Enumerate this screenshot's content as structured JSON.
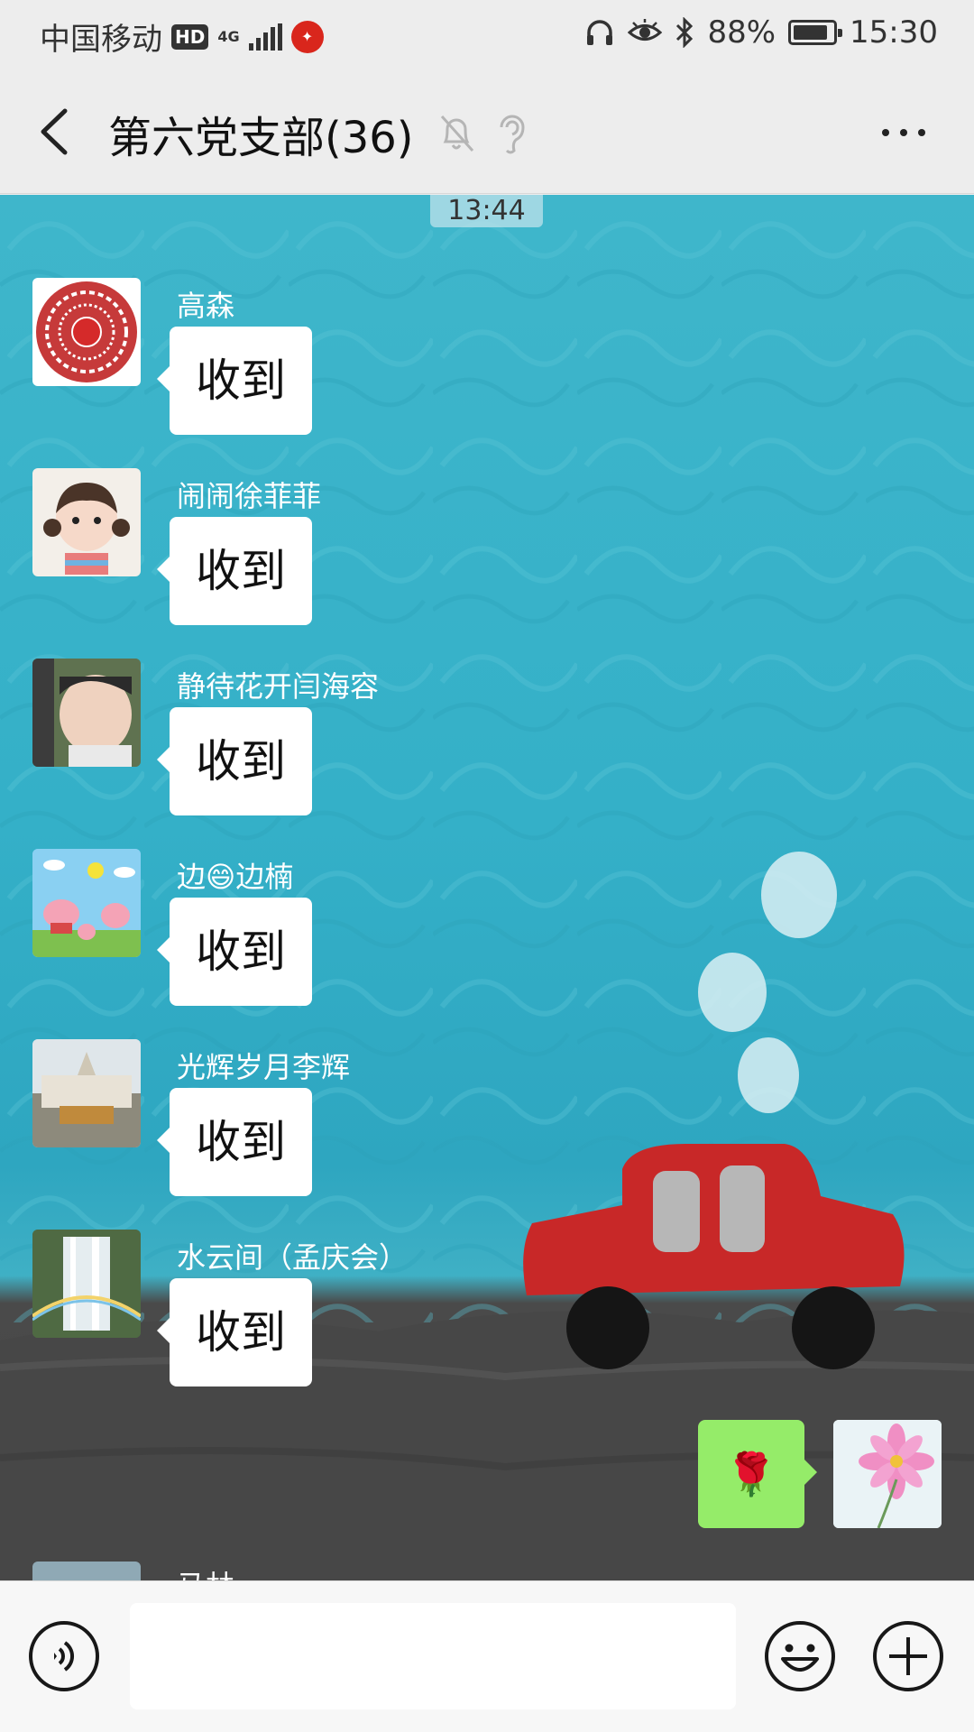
{
  "status_bar": {
    "carrier": "中国移动",
    "hd": "HD",
    "network": "4G",
    "battery_percent": "88%",
    "battery_level": 0.88,
    "time": "15:30"
  },
  "header": {
    "title": "第六党支部(36)"
  },
  "chat": {
    "timestamp": "13:44",
    "messages": [
      {
        "sender": "高森",
        "text": "收到"
      },
      {
        "sender": "闹闹徐菲菲",
        "text": "收到"
      },
      {
        "sender": "静待花开闫海容",
        "text": "收到"
      },
      {
        "sender": "边😄边楠",
        "text": "收到"
      },
      {
        "sender": "光辉岁月李辉",
        "text": "收到"
      },
      {
        "sender": "水云间（孟庆会）",
        "text": "收到"
      }
    ],
    "my_message": {
      "content": "🌹"
    },
    "partial_sender": "马林"
  },
  "input_bar": {
    "placeholder": ""
  },
  "colors": {
    "chat_background": "#34b0c8",
    "my_bubble": "#95ec69",
    "car": "#c82828"
  }
}
